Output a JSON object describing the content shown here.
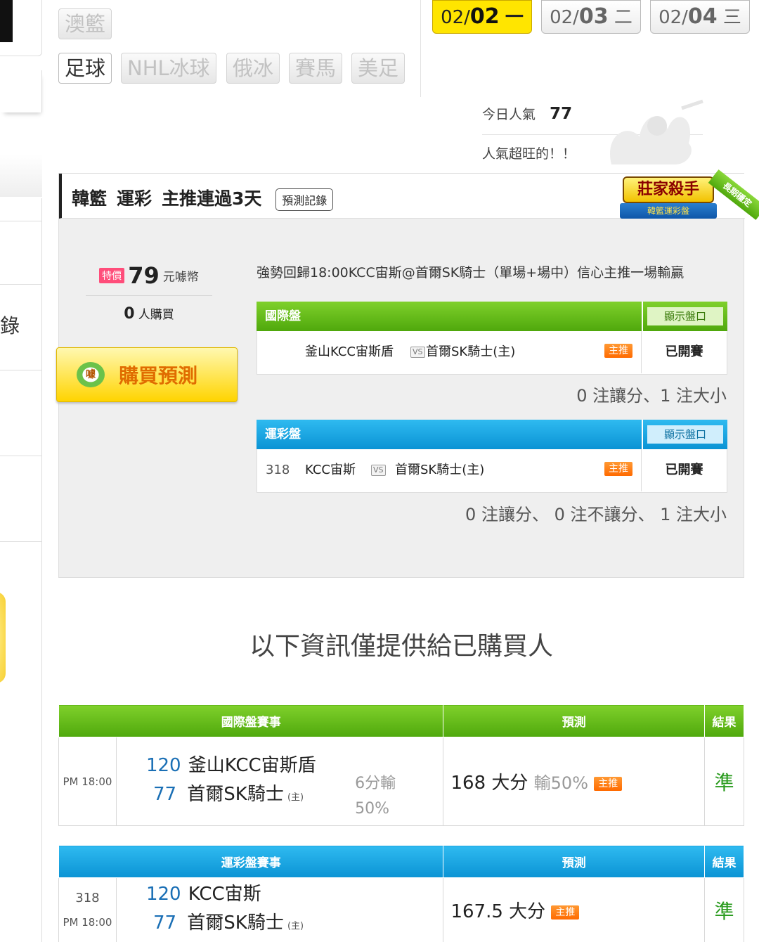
{
  "sports": {
    "row1": [
      {
        "label": "澳籃",
        "active": false
      }
    ],
    "row2": [
      {
        "label": "足球",
        "active": true
      },
      {
        "label": "NHL冰球",
        "active": false
      },
      {
        "label": "俄冰",
        "active": false
      },
      {
        "label": "賽馬",
        "active": false
      },
      {
        "label": "美足",
        "active": false
      }
    ]
  },
  "dates": [
    {
      "prefix": "02/",
      "day": "02",
      "weekday": "一",
      "active": true
    },
    {
      "prefix": "02/",
      "day": "03",
      "weekday": "二",
      "active": false
    },
    {
      "prefix": "02/",
      "day": "04",
      "weekday": "三",
      "active": false
    }
  ],
  "popularity": {
    "label": "今日人氣",
    "value": "77",
    "note": "人氣超旺的！！"
  },
  "left_strip": {
    "fragment": "錄"
  },
  "panel": {
    "title_league": "韓籃",
    "title_type": "運彩",
    "title_streak": "主推連過3天",
    "record_button": "預測記錄",
    "badge_main": "莊家殺手",
    "badge_sub": "韓籃運彩盤",
    "badge_ribbon": "長期穩定",
    "price_tag": "特價",
    "price": "79",
    "price_unit": "元噱幣",
    "buyers": "0",
    "buyers_unit": "人購買",
    "buy_button": "購買預測",
    "buy_icon": "噱",
    "description": "強勢回歸18:00KCC宙斯@首爾SK騎士（單場+場中）信心主推一場輸贏",
    "intl": {
      "header": "國際盤",
      "show_button": "顯示盤口",
      "away": "釜山KCC宙斯盾",
      "vs": "VS",
      "home": "首爾SK騎士(主)",
      "pick_badge": "主推",
      "status": "已開賽",
      "summary": "0 注讓分、1 注大小"
    },
    "lottery": {
      "header": "運彩盤",
      "show_button": "顯示盤口",
      "code": "318",
      "away": "KCC宙斯",
      "vs": "VS",
      "home": "首爾SK騎士(主)",
      "pick_badge": "主推",
      "status": "已開賽",
      "summary": "0 注讓分、 0 注不讓分、 1 注大小"
    }
  },
  "buyer_info": "以下資訊僅提供給已購買人",
  "intl_table": {
    "headers": [
      "國際盤賽事",
      "預測",
      "結果"
    ],
    "time": "PM 18:00",
    "away_score": "120",
    "away": "釜山KCC宙斯盾",
    "home_score": "77",
    "home": "首爾SK騎士",
    "home_tag": "(主)",
    "spread_line1": "6分輸",
    "spread_line2": "50%",
    "prediction": "168 大分",
    "prediction_extra": "輸50%",
    "pick_badge": "主推",
    "result": "準"
  },
  "lottery_table": {
    "headers": [
      "運彩盤賽事",
      "預測",
      "結果"
    ],
    "code": "318",
    "time": "PM 18:00",
    "away_score": "120",
    "away": "KCC宙斯",
    "home_score": "77",
    "home": "首爾SK騎士",
    "home_tag": "(主)",
    "prediction": "167.5 大分",
    "pick_badge": "主推",
    "result": "準"
  }
}
